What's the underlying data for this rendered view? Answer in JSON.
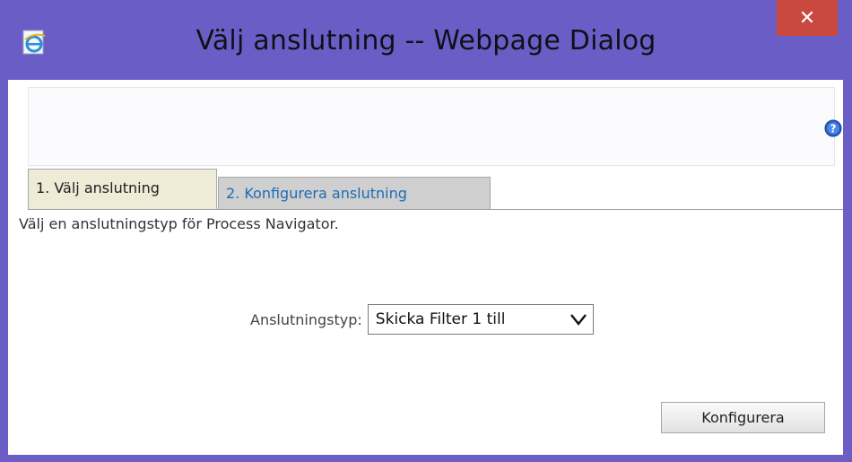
{
  "window": {
    "title": "Välj anslutning -- Webpage Dialog",
    "close_label": "✕"
  },
  "tabs": [
    {
      "label": "1. Välj anslutning",
      "active": true
    },
    {
      "label": "2. Konfigurera anslutning",
      "active": false
    }
  ],
  "main": {
    "description": "Välj en anslutningstyp för Process Navigator.",
    "connection_type": {
      "label": "Anslutningstyp:",
      "selected": "Skicka Filter 1 till"
    },
    "configure_label": "Konfigurera"
  },
  "icons": {
    "app": "internet-explorer-icon",
    "help": "help-icon",
    "close": "close-icon",
    "dropdown": "chevron-down-icon"
  },
  "colors": {
    "titlebar": "#6a5ec6",
    "close": "#c9483f",
    "active_tab": "#eeebd6",
    "inactive_tab": "#cfcfcf",
    "link": "#1f6cb5"
  }
}
